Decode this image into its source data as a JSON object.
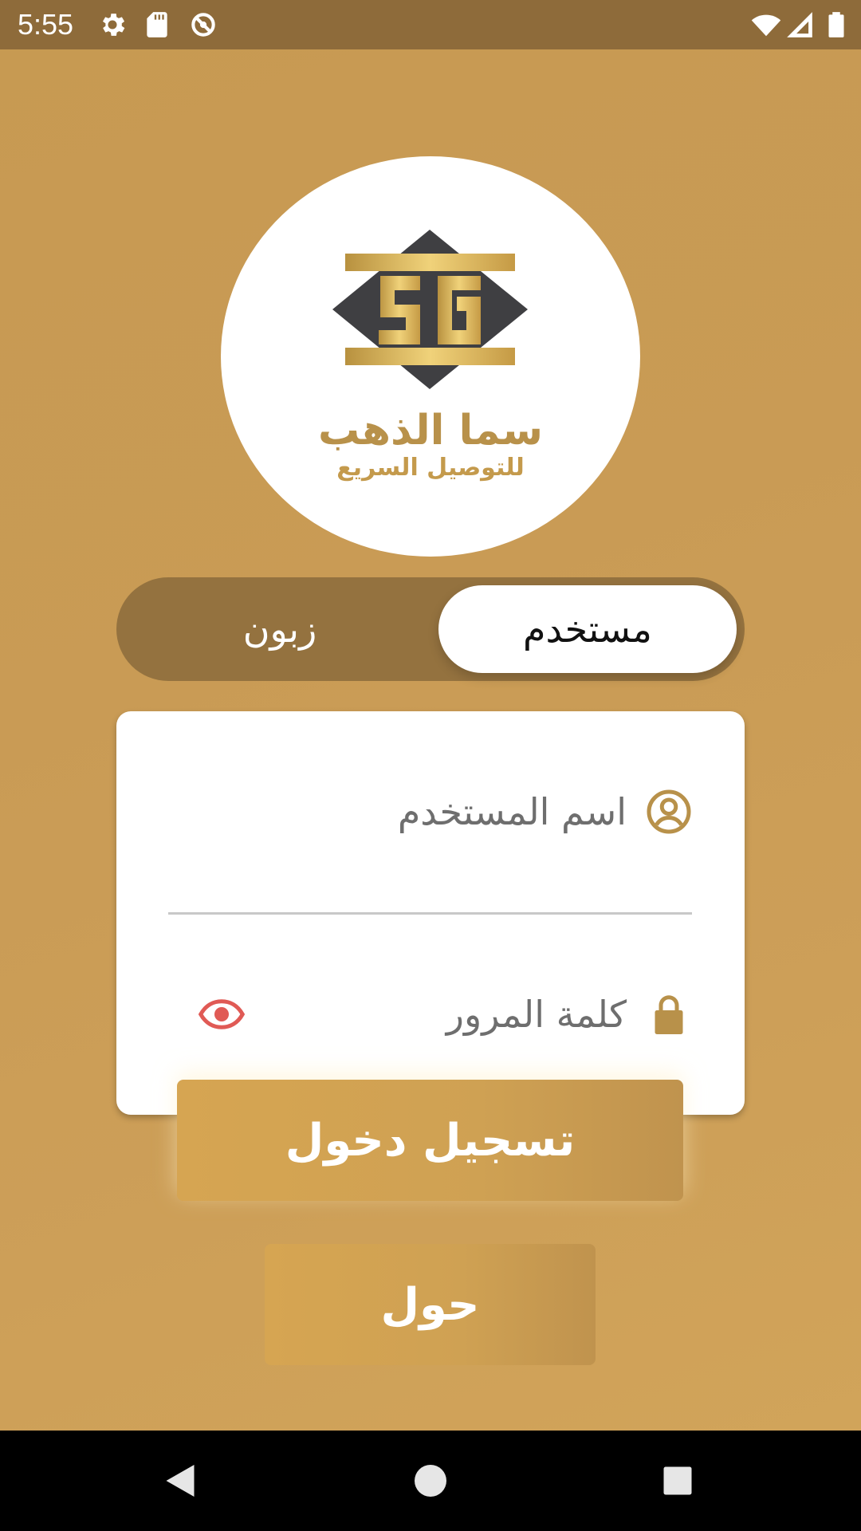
{
  "status_bar": {
    "time": "5:55",
    "icons": [
      "gear-icon",
      "sd-card-icon",
      "no-sync-icon",
      "wifi-icon",
      "signal-icon",
      "battery-icon"
    ]
  },
  "logo": {
    "mark_letters": "SG",
    "name_ar": "سما الذهب",
    "tagline_ar": "للتوصيل السريع"
  },
  "role_toggle": {
    "options": [
      {
        "label": "مستخدم",
        "selected": true
      },
      {
        "label": "زبون",
        "selected": false
      }
    ]
  },
  "form": {
    "username_placeholder": "اسم المستخدم",
    "password_placeholder": "كلمة المرور",
    "icons": {
      "username": "user-circle-icon",
      "password": "lock-icon",
      "toggle_visibility": "eye-icon"
    }
  },
  "actions": {
    "login_label": "تسجيل دخول",
    "about_label": "حول"
  },
  "navigation": {
    "buttons": [
      "back-icon",
      "home-icon",
      "recents-icon"
    ]
  },
  "colors": {
    "background": "#c99b55",
    "status_bar": "#8e6b3a",
    "toggle_track": "#94723f",
    "accent_gold": "#b8914a",
    "eye_icon": "#e05a55"
  }
}
